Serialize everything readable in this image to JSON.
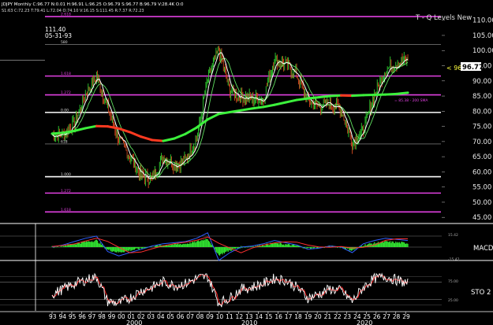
{
  "header": {
    "symbol_line": "JDJPY Monthly C:96.77 N:0.01 H:96.91 L:96.25 O:96.79 S:96.77 B:96.79 V:28.4K O:0",
    "indicator_line": "S1:63 C:72.23 T:79.41 L:72.04 O:74.10 V:16.15 S:111.45 R:7.37 R:72.23"
  },
  "cursor_info": {
    "value": "111.40",
    "date": "05-31-93"
  },
  "study_title": "T - Q Levels New",
  "last_price": {
    "label": "< 96.7",
    "tag": "96.77"
  },
  "ma_note": "= 85.38 - 200 SMA",
  "level_labels": [
    "2.618",
    "580",
    "1.618",
    "1.272",
    "0.00",
    "618",
    "1.000",
    "1.272",
    "1.618"
  ],
  "panel_labels": {
    "macd": "MACD",
    "sto": "STO 2"
  },
  "macd_ticks": [
    "15.42",
    "-15.42"
  ],
  "sto_ticks": [
    "75.00",
    "25.00"
  ],
  "colors": {
    "price_bars": "#2fd030",
    "price_dn": "#d44a20",
    "sma200": "#3cf03c",
    "sma200_down": "#ff3a20",
    "fast_ma": "#ffffff",
    "slow_ma": "#60e060",
    "magenta_level": "#e040e0",
    "white_level": "#ffffff",
    "macd_blue": "#3060ff",
    "macd_red": "#ff3030",
    "macd_hist": "#30e030",
    "sto_k": "#ffffff",
    "sto_d": "#ff2020"
  },
  "chart_data": {
    "type": "line",
    "x_labels": [
      "93",
      "94",
      "95",
      "96",
      "97",
      "98",
      "99",
      "00",
      "01",
      "02",
      "03",
      "04",
      "05",
      "06",
      "07",
      "08",
      "09",
      "10",
      "11",
      "12",
      "13",
      "14",
      "15",
      "16",
      "17",
      "18",
      "19",
      "20",
      "21",
      "22",
      "23",
      "24",
      "25",
      "26",
      "27",
      "28",
      "29"
    ],
    "x_decade_labels": [
      "2000",
      "2010",
      "2020"
    ],
    "y_ticks": [
      110,
      105,
      100,
      95,
      90,
      85,
      80,
      75,
      70,
      65,
      60,
      55,
      50,
      45
    ],
    "ylim": [
      43.5,
      112
    ],
    "levels": [
      {
        "value": 111.2,
        "color": "magenta"
      },
      {
        "value": 102.0,
        "color": "grey"
      },
      {
        "value": 91.6,
        "color": "magenta"
      },
      {
        "value": 85.4,
        "color": "magenta"
      },
      {
        "value": 79.6,
        "color": "white"
      },
      {
        "value": 69.2,
        "color": "grey"
      },
      {
        "value": 58.4,
        "color": "white"
      },
      {
        "value": 53.0,
        "color": "magenta"
      },
      {
        "value": 46.8,
        "color": "magenta"
      }
    ],
    "price_close": [
      72.2,
      72.5,
      75.8,
      85.5,
      91.5,
      81.0,
      70.6,
      65.2,
      58.8,
      57.6,
      64.9,
      62.5,
      63.7,
      70.8,
      90.6,
      100.4,
      86.7,
      84.8,
      84.3,
      84.0,
      97.2,
      95.4,
      92.1,
      83.4,
      81.5,
      82.6,
      80.6,
      69.4,
      73.8,
      85.5,
      93.8,
      96.0,
      96.8
    ],
    "sma200": [
      72.6,
      72.9,
      73.5,
      74.4,
      75.1,
      75.0,
      74.3,
      73.1,
      71.6,
      70.5,
      70.2,
      71.0,
      72.5,
      74.6,
      77.3,
      79.1,
      79.7,
      80.3,
      80.9,
      81.4,
      82.1,
      82.9,
      83.7,
      84.2,
      84.6,
      85.0,
      85.2,
      85.1,
      85.3,
      85.4,
      85.5,
      85.7,
      86.1
    ],
    "macd": [
      0,
      2,
      5,
      8,
      10,
      -4,
      -8,
      -5,
      -2,
      1,
      3,
      4,
      5,
      8,
      13,
      -12,
      -5,
      0,
      1,
      3,
      6,
      4,
      2,
      -2,
      -1,
      1,
      0,
      -5,
      3,
      6,
      8,
      7,
      6
    ],
    "stochastic": [
      40,
      55,
      70,
      80,
      90,
      20,
      15,
      30,
      50,
      60,
      75,
      65,
      70,
      85,
      90,
      15,
      30,
      55,
      60,
      70,
      85,
      80,
      60,
      30,
      40,
      55,
      50,
      20,
      60,
      85,
      90,
      80,
      70
    ],
    "sto_levels": [
      75,
      25
    ]
  }
}
